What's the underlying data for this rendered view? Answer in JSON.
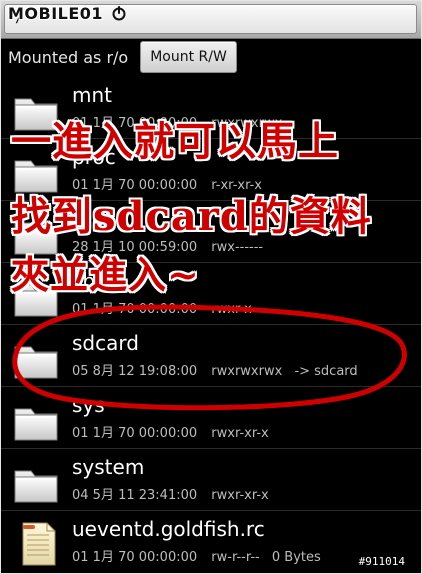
{
  "header": {
    "watermark": "MOBILE01",
    "path_text": "/"
  },
  "mount_row": {
    "status_label": "Mounted as r/o",
    "mount_button_label": "Mount R/W"
  },
  "list": {
    "items": [
      {
        "name": "mnt",
        "date": "01 1月 70 00:00:00",
        "perm": "rwxrwxrwx",
        "target": "",
        "icon": "folder-icon"
      },
      {
        "name": "proc",
        "date": "01 1月 70 00:00:00",
        "perm": "r-xr-xr-x",
        "target": "",
        "icon": "folder-icon"
      },
      {
        "name": "root",
        "date": "28 1月 10 00:59:00",
        "perm": "rwx------",
        "target": "",
        "icon": "folder-icon"
      },
      {
        "name": "sbin",
        "date": "01 1月 70 00:00:00",
        "perm": "rwxr-x---",
        "target": "",
        "icon": "folder-icon"
      },
      {
        "name": "sdcard",
        "date": "05 8月 12 19:08:00",
        "perm": "rwxrwxrwx",
        "target": "-> sdcard",
        "icon": "folder-icon"
      },
      {
        "name": "sys",
        "date": "01 1月 70 00:00:00",
        "perm": "rwxr-xr-x",
        "target": "",
        "icon": "folder-icon"
      },
      {
        "name": "system",
        "date": "04 5月 11 23:41:00",
        "perm": "rwxr-xr-x",
        "target": "",
        "icon": "folder-icon"
      },
      {
        "name": "ueventd.goldfish.rc",
        "date": "01 1月 70 00:00:00",
        "perm": "rw-r--r--",
        "target": "0 Bytes",
        "icon": "document-icon"
      }
    ]
  },
  "annotation": {
    "line1": "一進入就可以馬上",
    "line2": "找到sdcard的資料",
    "line3": "夾並進入~"
  },
  "footer": {
    "image_id": "#911014"
  },
  "colors": {
    "annotation_red": "#d10000",
    "background": "#000000",
    "text_primary": "#ffffff",
    "text_secondary": "#bdbdbd"
  }
}
